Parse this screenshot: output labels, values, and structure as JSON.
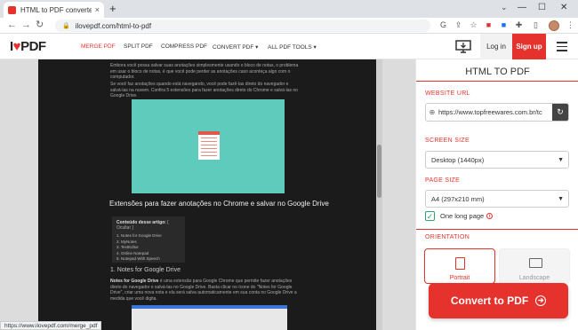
{
  "browser": {
    "tab_title": "HTML to PDF converter. Transfor",
    "tab_close": "×",
    "new_tab": "+",
    "url": "ilovepdf.com/html-to-pdf",
    "status_url": "https://www.ilovepdf.com/merge_pdf"
  },
  "header": {
    "logo_i": "I",
    "logo_heart": "♥",
    "logo_pdf": "PDF",
    "nav": [
      "MERGE PDF",
      "SPLIT PDF",
      "COMPRESS PDF",
      "CONVERT PDF ▾",
      "ALL PDF TOOLS ▾"
    ],
    "login": "Log in",
    "signup": "Sign up"
  },
  "preview": {
    "para1": "Embora você possa salvar suas anotações simplesmente usando o bloco de notas, o problema em usar o bloco de notas, é que você pode perder as anotações caso aconteça algo com o computador.",
    "para2": "Se você faz anotações quando está navegando, você pode fazê-las direto do navegador e salvá-las na nuvem. Confira 5 extensões para fazer anotações direto do Chrome e salvá-las no Google Drive.",
    "heading": "Extensões para fazer anotações no Chrome e salvar no Google Drive",
    "toc_title": "Conteúdo desse artigo:",
    "toc_hide": "[ Ocultar ]",
    "toc_items": [
      "1. Notes for Google Drive",
      "2. MyNotes",
      "3. TextEditor",
      "4. Online Notepad",
      "5. Notepad With Speech"
    ],
    "subheading": "1. Notes for Google Drive",
    "para3_bold": "Notes for Google Drive",
    "para3": " é uma extensão para Google Chrome que permite fazer anotações direto do navegador e salvá-las no Google Drive. Basta clicar no ícone do \"Notes for Google Drive\", criar uma nova nota e ela será salva automaticamente em sua conta no Google Drive a medida que você digita."
  },
  "sidebar": {
    "title": "HTML TO PDF",
    "website_url_label": "WEBSITE URL",
    "website_url_value": "https://www.topfreewares.com.br/tc",
    "screen_size_label": "SCREEN SIZE",
    "screen_size_value": "Desktop (1440px)",
    "page_size_label": "PAGE SIZE",
    "page_size_value": "A4 (297x210 mm)",
    "one_long_page": "One long page",
    "orientation_label": "ORIENTATION",
    "portrait": "Portrait",
    "landscape": "Landscape",
    "convert_button": "Convert to PDF"
  },
  "colors": {
    "brand": "#e5322d",
    "check": "#2ea36c"
  }
}
